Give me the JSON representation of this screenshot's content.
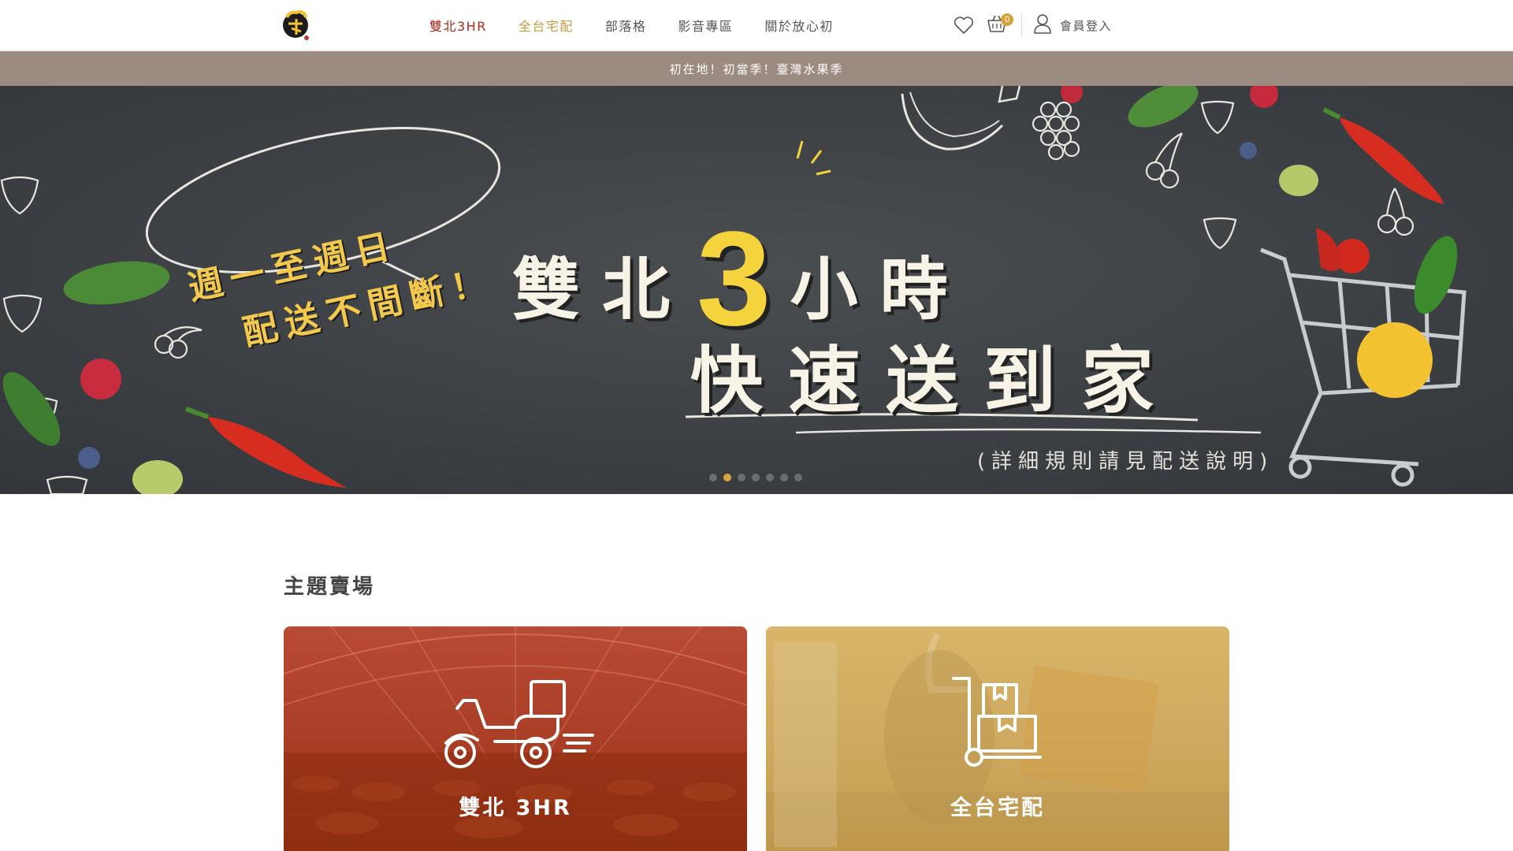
{
  "header": {
    "logo_name": "放心初",
    "nav": [
      {
        "label": "雙北3HR",
        "color": "#a8291c"
      },
      {
        "label": "全台宅配",
        "color": "#c49a3d"
      },
      {
        "label": "部落格"
      },
      {
        "label": "影音專區"
      },
      {
        "label": "關於放心初"
      }
    ],
    "icons": {
      "favorites": "heart-icon",
      "cart": "cart-icon",
      "account": "user-icon"
    },
    "cart_count": "0",
    "login_label": "會員登入"
  },
  "announcement": "初在地！初當季！臺灣水果季",
  "banner": {
    "bubble_line1": "週一至週日",
    "bubble_line2": "配送不間斷！",
    "headline_a": "雙北",
    "headline_num": "3",
    "headline_b": "小時",
    "headline_line2": "快速送到家",
    "note": "(詳細規則請見配送說明)",
    "slides": 7,
    "active_slide": 2
  },
  "section": {
    "title": "主題賣場",
    "categories": [
      {
        "label": "雙北 3HR",
        "icon": "scooter-delivery-icon",
        "color": "#a83d24"
      },
      {
        "label": "全台宅配",
        "icon": "hand-truck-box-icon",
        "color": "#ceaa60"
      }
    ]
  },
  "colors": {
    "accent_red": "#a8291c",
    "accent_gold": "#d8a340",
    "announce_bg": "#9c8b80"
  }
}
